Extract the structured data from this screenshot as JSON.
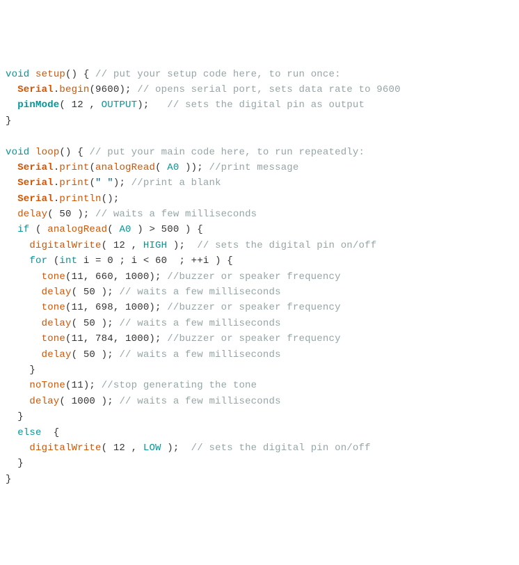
{
  "lines": [
    [
      [
        "kw",
        "void"
      ],
      [
        "p",
        " "
      ],
      [
        "fn",
        "setup"
      ],
      [
        "p",
        "() { "
      ],
      [
        "cmt",
        "// put your setup code here, to run once:"
      ]
    ],
    [
      [
        "p",
        "  "
      ],
      [
        "typ",
        "Serial"
      ],
      [
        "p",
        "."
      ],
      [
        "fn",
        "begin"
      ],
      [
        "p",
        "(9600); "
      ],
      [
        "cmt",
        "// opens serial port, sets data rate to 9600 "
      ]
    ],
    [
      [
        "p",
        "  "
      ],
      [
        "pin",
        "pinMode"
      ],
      [
        "p",
        "( 12 , "
      ],
      [
        "const",
        "OUTPUT"
      ],
      [
        "p",
        ");   "
      ],
      [
        "cmt",
        "// sets the digital pin as output"
      ]
    ],
    [
      [
        "p",
        "}"
      ]
    ],
    [
      [
        "p",
        ""
      ]
    ],
    [
      [
        "kw",
        "void"
      ],
      [
        "p",
        " "
      ],
      [
        "fn",
        "loop"
      ],
      [
        "p",
        "() { "
      ],
      [
        "cmt",
        "// put your main code here, to run repeatedly:"
      ]
    ],
    [
      [
        "p",
        "  "
      ],
      [
        "typ",
        "Serial"
      ],
      [
        "p",
        "."
      ],
      [
        "fn",
        "print"
      ],
      [
        "p",
        "("
      ],
      [
        "fn",
        "analogRead"
      ],
      [
        "p",
        "( "
      ],
      [
        "const",
        "A0"
      ],
      [
        "p",
        " )); "
      ],
      [
        "cmt",
        "//print message"
      ]
    ],
    [
      [
        "p",
        "  "
      ],
      [
        "typ",
        "Serial"
      ],
      [
        "p",
        "."
      ],
      [
        "fn",
        "print"
      ],
      [
        "p",
        "("
      ],
      [
        "str",
        "\" \""
      ],
      [
        "p",
        "); "
      ],
      [
        "cmt",
        "//print a blank"
      ]
    ],
    [
      [
        "p",
        "  "
      ],
      [
        "typ",
        "Serial"
      ],
      [
        "p",
        "."
      ],
      [
        "fn",
        "println"
      ],
      [
        "p",
        "();"
      ]
    ],
    [
      [
        "p",
        "  "
      ],
      [
        "fn",
        "delay"
      ],
      [
        "p",
        "( 50 ); "
      ],
      [
        "cmt",
        "// waits a few milliseconds"
      ]
    ],
    [
      [
        "p",
        "  "
      ],
      [
        "kw",
        "if"
      ],
      [
        "p",
        " ( "
      ],
      [
        "fn",
        "analogRead"
      ],
      [
        "p",
        "( "
      ],
      [
        "const",
        "A0"
      ],
      [
        "p",
        " ) > 500 ) {"
      ]
    ],
    [
      [
        "p",
        "    "
      ],
      [
        "dw",
        "digitalWrite"
      ],
      [
        "p",
        "( 12 , "
      ],
      [
        "const",
        "HIGH"
      ],
      [
        "p",
        " );  "
      ],
      [
        "cmt",
        "// sets the digital pin on/off"
      ]
    ],
    [
      [
        "p",
        "    "
      ],
      [
        "kw",
        "for"
      ],
      [
        "p",
        " ("
      ],
      [
        "kw",
        "int"
      ],
      [
        "p",
        " i = 0 ; i < 60  ; ++i ) {"
      ]
    ],
    [
      [
        "p",
        "      "
      ],
      [
        "fn",
        "tone"
      ],
      [
        "p",
        "(11, 660, 1000); "
      ],
      [
        "cmt",
        "//buzzer or speaker frequency"
      ]
    ],
    [
      [
        "p",
        "      "
      ],
      [
        "fn",
        "delay"
      ],
      [
        "p",
        "( 50 ); "
      ],
      [
        "cmt",
        "// waits a few milliseconds"
      ]
    ],
    [
      [
        "p",
        "      "
      ],
      [
        "fn",
        "tone"
      ],
      [
        "p",
        "(11, 698, 1000); "
      ],
      [
        "cmt",
        "//buzzer or speaker frequency"
      ]
    ],
    [
      [
        "p",
        "      "
      ],
      [
        "fn",
        "delay"
      ],
      [
        "p",
        "( 50 ); "
      ],
      [
        "cmt",
        "// waits a few milliseconds"
      ]
    ],
    [
      [
        "p",
        "      "
      ],
      [
        "fn",
        "tone"
      ],
      [
        "p",
        "(11, 784, 1000); "
      ],
      [
        "cmt",
        "//buzzer or speaker frequency"
      ]
    ],
    [
      [
        "p",
        "      "
      ],
      [
        "fn",
        "delay"
      ],
      [
        "p",
        "( 50 ); "
      ],
      [
        "cmt",
        "// waits a few milliseconds"
      ]
    ],
    [
      [
        "p",
        "    }"
      ]
    ],
    [
      [
        "p",
        "    "
      ],
      [
        "fn",
        "noTone"
      ],
      [
        "p",
        "(11); "
      ],
      [
        "cmt",
        "//stop generating the tone"
      ]
    ],
    [
      [
        "p",
        "    "
      ],
      [
        "fn",
        "delay"
      ],
      [
        "p",
        "( 1000 ); "
      ],
      [
        "cmt",
        "// waits a few milliseconds"
      ]
    ],
    [
      [
        "p",
        "  }"
      ]
    ],
    [
      [
        "p",
        "  "
      ],
      [
        "kw",
        "else"
      ],
      [
        "p",
        "  {"
      ]
    ],
    [
      [
        "p",
        "    "
      ],
      [
        "dw",
        "digitalWrite"
      ],
      [
        "p",
        "( 12 , "
      ],
      [
        "const",
        "LOW"
      ],
      [
        "p",
        " );  "
      ],
      [
        "cmt",
        "// sets the digital pin on/off"
      ]
    ],
    [
      [
        "p",
        "  }"
      ]
    ],
    [
      [
        "p",
        "}"
      ]
    ]
  ]
}
